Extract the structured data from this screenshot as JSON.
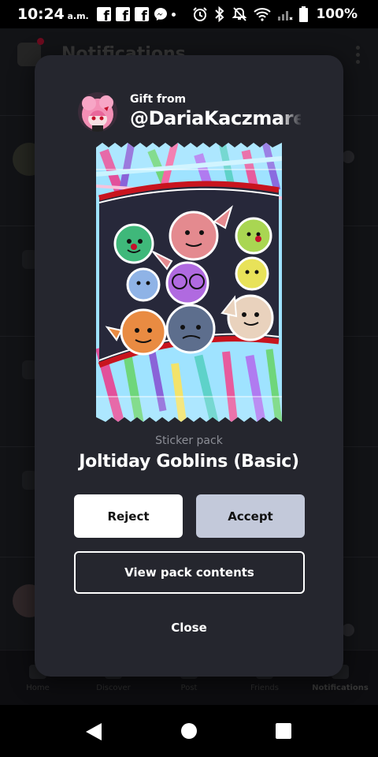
{
  "status_bar": {
    "time": "10:24",
    "time_suffix": "a.m.",
    "notification_icons": [
      "facebook-icon",
      "facebook-icon",
      "facebook-icon",
      "messenger-icon",
      "dot-icon"
    ],
    "system_icons": [
      "alarm-icon",
      "bluetooth-icon",
      "mute-icon",
      "wifi-icon",
      "signal-icon",
      "battery-icon"
    ],
    "battery": "100%"
  },
  "background_app": {
    "header_title": "Notifications",
    "nav": [
      {
        "label": "Home",
        "icon": "home-icon"
      },
      {
        "label": "Discover",
        "icon": "search-icon"
      },
      {
        "label": "Post",
        "icon": "post-icon"
      },
      {
        "label": "Friends",
        "icon": "friends-icon"
      },
      {
        "label": "Notifications",
        "icon": "bell-icon"
      }
    ]
  },
  "gift_modal": {
    "gift_from_label": "Gift from",
    "sender_username": "@DariaKaczmarek",
    "pack_type": "Sticker pack",
    "pack_name": "Joltiday Goblins (Basic)",
    "reject_label": "Reject",
    "accept_label": "Accept",
    "view_contents_label": "View pack contents",
    "close_label": "Close",
    "colors": {
      "modal_bg": "#25262e",
      "accept_bg": "#c3c9da",
      "reject_bg": "#ffffff",
      "pack_ribbon": "#c8141e"
    }
  },
  "android_nav": {
    "buttons": [
      "back-icon",
      "home-icon",
      "recents-icon"
    ]
  }
}
